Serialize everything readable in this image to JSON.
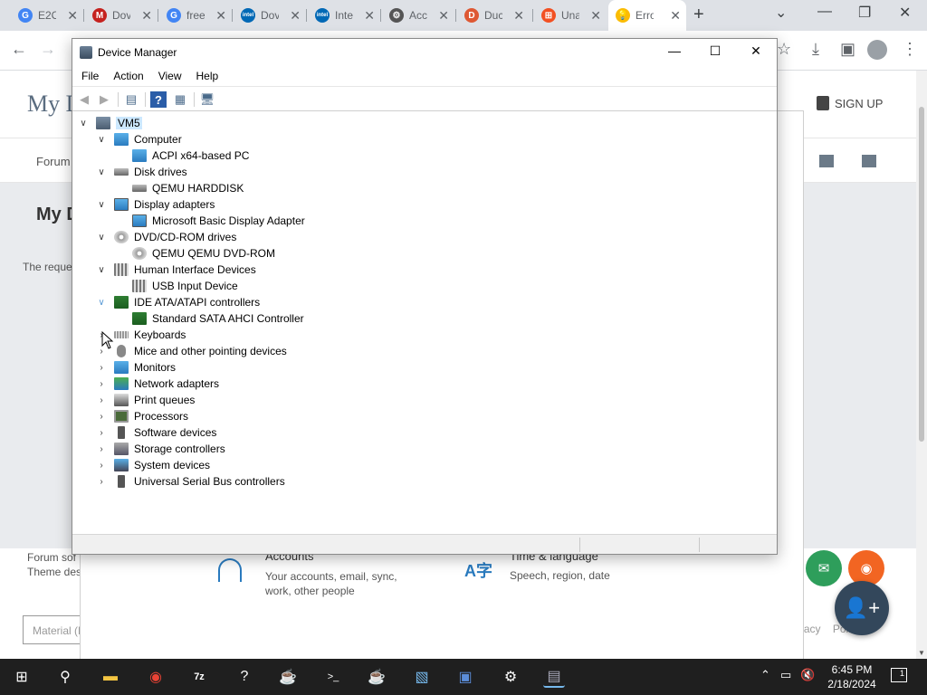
{
  "browser": {
    "tabs": [
      {
        "label": "E2C",
        "fav": "G",
        "color": "#4285f4"
      },
      {
        "label": "Dov",
        "fav": "M",
        "color": "#c5221f"
      },
      {
        "label": "free",
        "fav": "G",
        "color": "#4285f4"
      },
      {
        "label": "Dov",
        "fav": "intel",
        "color": "#0068b5"
      },
      {
        "label": "Inte",
        "fav": "intel",
        "color": "#0068b5"
      },
      {
        "label": "Acc",
        "fav": "⚙",
        "color": "#555555"
      },
      {
        "label": "Duc",
        "fav": "D",
        "color": "#de5833"
      },
      {
        "label": "Una",
        "fav": "⊞",
        "color": "#f25022"
      },
      {
        "label": "Erro",
        "fav": "💡",
        "color": "#fbbc04"
      }
    ],
    "new_tab": "+",
    "page": {
      "site_title": "My D",
      "signup": "SIGN UP",
      "forum_link": "Forum",
      "heading": "My D",
      "text": "The reque",
      "footer_line1": "Forum sof",
      "footer_line2": "Theme des",
      "material_button": "Material (Default)",
      "footer_links": "Home  Contact Us  Help  Terms and Rules  Privacy Policy",
      "settings_accounts_title": "Accounts",
      "settings_accounts_desc1": "Your accounts, email, sync,",
      "settings_accounts_desc2": "work, other people",
      "settings_time_title": "Time & language",
      "settings_time_desc": "Speech, region, date"
    }
  },
  "device_manager": {
    "title": "Device Manager",
    "menu": [
      "File",
      "Action",
      "View",
      "Help"
    ],
    "tree": [
      {
        "label": "VM5",
        "level": 0,
        "chev": "∨",
        "icon": "ic-root",
        "name": "tree-root-vm5",
        "root": true
      },
      {
        "label": "Computer",
        "level": 1,
        "chev": "∨",
        "icon": "ic-pc",
        "name": "tree-item-computer"
      },
      {
        "label": "ACPI x64-based PC",
        "level": 2,
        "chev": "",
        "icon": "ic-pc",
        "name": "tree-item-acpi-pc"
      },
      {
        "label": "Disk drives",
        "level": 1,
        "chev": "∨",
        "icon": "ic-disk",
        "name": "tree-item-disk-drives"
      },
      {
        "label": "QEMU HARDDISK",
        "level": 2,
        "chev": "",
        "icon": "ic-disk",
        "name": "tree-item-qemu-harddisk"
      },
      {
        "label": "Display adapters",
        "level": 1,
        "chev": "∨",
        "icon": "ic-display",
        "name": "tree-item-display-adapters"
      },
      {
        "label": "Microsoft Basic Display Adapter",
        "level": 2,
        "chev": "",
        "icon": "ic-display",
        "name": "tree-item-basic-display-adapter"
      },
      {
        "label": "DVD/CD-ROM drives",
        "level": 1,
        "chev": "∨",
        "icon": "ic-dvd",
        "name": "tree-item-dvd-drives"
      },
      {
        "label": "QEMU QEMU DVD-ROM",
        "level": 2,
        "chev": "",
        "icon": "ic-dvd",
        "name": "tree-item-qemu-dvd-rom"
      },
      {
        "label": "Human Interface Devices",
        "level": 1,
        "chev": "∨",
        "icon": "ic-hid",
        "name": "tree-item-hid"
      },
      {
        "label": "USB Input Device",
        "level": 2,
        "chev": "",
        "icon": "ic-hid",
        "name": "tree-item-usb-input-device"
      },
      {
        "label": "IDE ATA/ATAPI controllers",
        "level": 1,
        "chev": "∨",
        "icon": "ic-ide",
        "name": "tree-item-ide-controllers",
        "ide": true
      },
      {
        "label": "Standard SATA AHCI Controller",
        "level": 2,
        "chev": "",
        "icon": "ic-ide",
        "name": "tree-item-sata-ahci-controller"
      },
      {
        "label": "Keyboards",
        "level": 1,
        "chev": "›",
        "icon": "ic-kb",
        "name": "tree-item-keyboards"
      },
      {
        "label": "Mice and other pointing devices",
        "level": 1,
        "chev": "›",
        "icon": "ic-mouse",
        "name": "tree-item-mice"
      },
      {
        "label": "Monitors",
        "level": 1,
        "chev": "›",
        "icon": "ic-mon",
        "name": "tree-item-monitors"
      },
      {
        "label": "Network adapters",
        "level": 1,
        "chev": "›",
        "icon": "ic-net",
        "name": "tree-item-network-adapters"
      },
      {
        "label": "Print queues",
        "level": 1,
        "chev": "›",
        "icon": "ic-print",
        "name": "tree-item-print-queues"
      },
      {
        "label": "Processors",
        "level": 1,
        "chev": "›",
        "icon": "ic-cpu",
        "name": "tree-item-processors"
      },
      {
        "label": "Software devices",
        "level": 1,
        "chev": "›",
        "icon": "ic-soft",
        "name": "tree-item-software-devices"
      },
      {
        "label": "Storage controllers",
        "level": 1,
        "chev": "›",
        "icon": "ic-stor",
        "name": "tree-item-storage-controllers"
      },
      {
        "label": "System devices",
        "level": 1,
        "chev": "›",
        "icon": "ic-sys",
        "name": "tree-item-system-devices"
      },
      {
        "label": "Universal Serial Bus controllers",
        "level": 1,
        "chev": "›",
        "icon": "ic-usb",
        "name": "tree-item-usb-controllers"
      }
    ]
  },
  "taskbar": {
    "clock_time": "6:45 PM",
    "clock_date": "2/18/2024",
    "notification_count": "1"
  },
  "colors": {
    "selection": "#cce8ff",
    "taskbar": "#1f1f1f",
    "fab_mail": "#2e9e5b",
    "fab_rss": "#f26522",
    "fab_adduser": "#33475b"
  }
}
